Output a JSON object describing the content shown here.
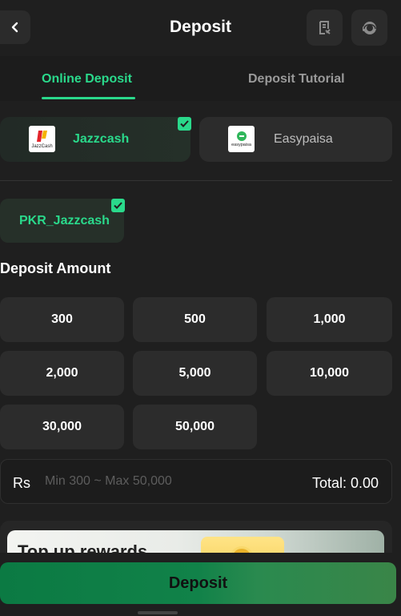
{
  "header": {
    "title": "Deposit",
    "back_icon": "chevron-left-icon",
    "history_icon": "receipt-icon",
    "support_icon": "customer-service-icon"
  },
  "tabs": [
    {
      "label": "Online Deposit",
      "active": true
    },
    {
      "label": "Deposit Tutorial",
      "active": false
    }
  ],
  "methods": [
    {
      "label": "Jazzcash",
      "logo_text": "JazzCash",
      "selected": true
    },
    {
      "label": "Easypaisa",
      "logo_text": "easypaisa",
      "selected": false
    }
  ],
  "channel": {
    "label": "PKR_Jazzcash",
    "selected": true
  },
  "amount_section": {
    "title": "Deposit Amount",
    "presets": [
      "300",
      "500",
      "1,000",
      "2,000",
      "5,000",
      "10,000",
      "30,000",
      "50,000"
    ]
  },
  "input": {
    "currency": "Rs",
    "placeholder": "Min 300 ~ Max 50,000",
    "value": "",
    "total_label": "Total: 0.00"
  },
  "promo": {
    "title": "Top up rewards"
  },
  "submit": {
    "label": "Deposit"
  },
  "colors": {
    "accent": "#2ad98b",
    "background": "#1f1f1f",
    "button": "#0b7a43"
  }
}
